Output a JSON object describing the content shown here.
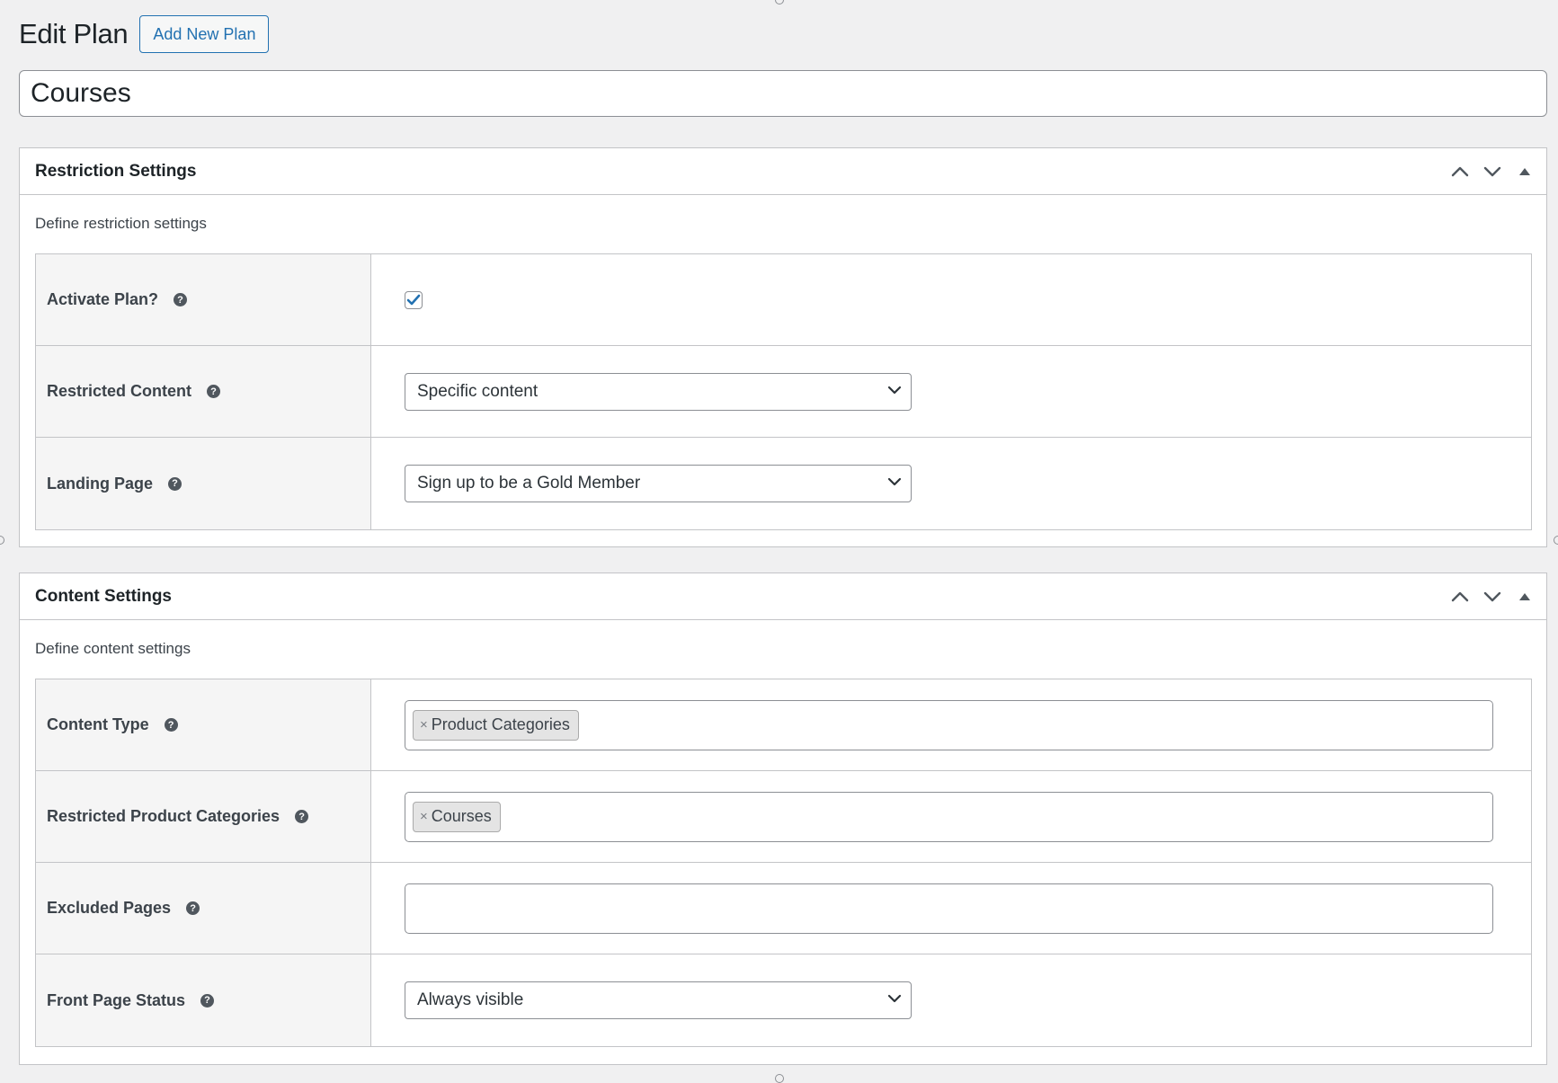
{
  "header": {
    "title": "Edit Plan",
    "add_new_label": "Add New Plan"
  },
  "plan_title": {
    "value": "Courses"
  },
  "restriction": {
    "title": "Restriction Settings",
    "description": "Define restriction settings",
    "rows": {
      "activate": {
        "label": "Activate Plan?",
        "checked": true
      },
      "restricted_content": {
        "label": "Restricted Content",
        "value": "Specific content"
      },
      "landing_page": {
        "label": "Landing Page",
        "value": "Sign up to be a Gold Member"
      }
    }
  },
  "content": {
    "title": "Content Settings",
    "description": "Define content settings",
    "rows": {
      "content_type": {
        "label": "Content Type",
        "tag": "Product Categories"
      },
      "product_categories": {
        "label": "Restricted Product Categories",
        "tag": "Courses"
      },
      "excluded_pages": {
        "label": "Excluded Pages"
      },
      "front_page_status": {
        "label": "Front Page Status",
        "value": "Always visible"
      }
    }
  },
  "icons": {
    "help": "question-circle-icon",
    "move_up": "chevron-up-icon",
    "move_down": "chevron-down-icon",
    "toggle": "triangle-up-icon",
    "remove": "times-icon"
  },
  "colors": {
    "accent": "#2271b1",
    "background": "#f0f0f1",
    "border": "#c3c4c7"
  }
}
